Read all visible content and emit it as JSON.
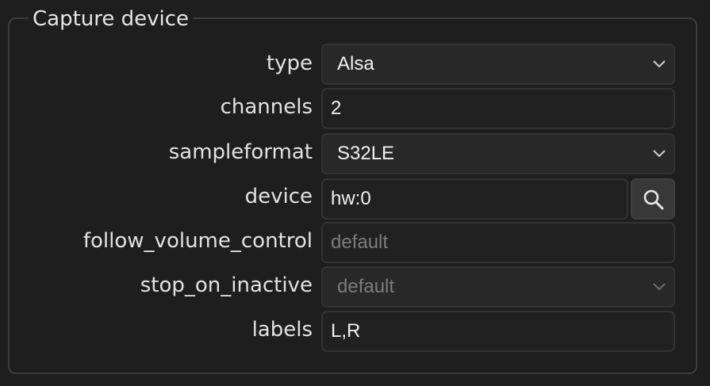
{
  "group": {
    "title": "Capture device"
  },
  "fields": {
    "type": {
      "label": "type",
      "value": "Alsa"
    },
    "channels": {
      "label": "channels",
      "value": "2"
    },
    "sampleformat": {
      "label": "sampleformat",
      "value": "S32LE"
    },
    "device": {
      "label": "device",
      "value": "hw:0",
      "button_icon": "search-icon"
    },
    "follow_volume_control": {
      "label": "follow_volume_control",
      "placeholder": "default"
    },
    "stop_on_inactive": {
      "label": "stop_on_inactive",
      "value": "default"
    },
    "labels": {
      "label": "labels",
      "value": "L,R"
    }
  },
  "colors": {
    "background": "#1e1e1e",
    "field_background": "#212121",
    "field_border": "#333333",
    "text": "#e6e6e6",
    "placeholder_text": "#7c7c7c"
  }
}
